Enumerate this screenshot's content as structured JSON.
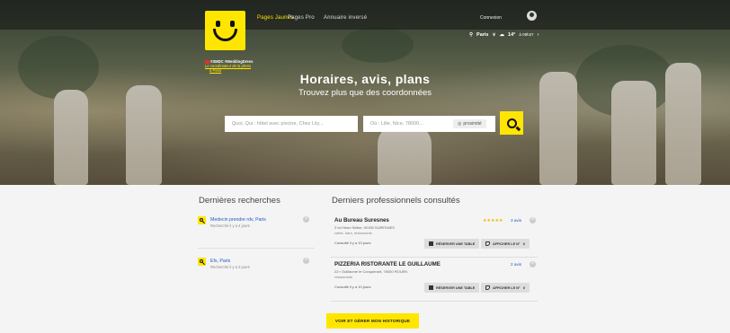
{
  "header": {
    "nav": [
      "Pages Jaunes",
      "Pages Pro",
      "Annuaire inversé"
    ],
    "login_label": "Connexion",
    "weather": {
      "city": "Paris",
      "temp": "14°",
      "time": "à 09h37"
    }
  },
  "hero": {
    "credit_title": "#SMDC #WeddingDress",
    "credit_sub": "Le coordinateur de la photo",
    "credit_sub2": "à Paris",
    "title": "Horaires, avis, plans",
    "subtitle": "Trouvez plus que des coordonnées",
    "what_placeholder": "Quoi, Qui : hôtel avec piscine, Chez Lily...",
    "where_placeholder": "Où : Lille, Nice, 78000...",
    "around_label": "proximité"
  },
  "history": {
    "title": "Dernières recherches",
    "items": [
      {
        "label": "Medecin prendre rdv, Paris",
        "meta": "Recherché il y a 4 jours"
      },
      {
        "label": "Efs, Paris",
        "meta": "Recherché il y a 3 jours"
      }
    ]
  },
  "pros": {
    "title": "Derniers professionnels consultés",
    "items": [
      {
        "name": "Au Bureau Suresnes",
        "address": "2 bd Henri Sellier, 92150 SURESNES",
        "category": "cafés, bars, restaurants",
        "meta": "Consulté il y a 10 jours",
        "stars": "★★★★★",
        "avis": "3 avis"
      },
      {
        "name": "PIZZERIA RISTORANTE LE GUILLAUME",
        "address": "22 r Guillaume le Conquérant, 76000 ROUEN",
        "category": "restaurants",
        "meta": "Consulté il y a 10 jours",
        "stars": "",
        "avis": "2 avis"
      }
    ],
    "reserve_label": "RÉSERVER UNE TABLE",
    "phone_label": "AFFICHER LE N°"
  },
  "history_button": "VOIR ET GÉRER MON HISTORIQUE",
  "colors": {
    "brand_yellow": "#ffe600",
    "link_blue": "#1a5dc4"
  }
}
